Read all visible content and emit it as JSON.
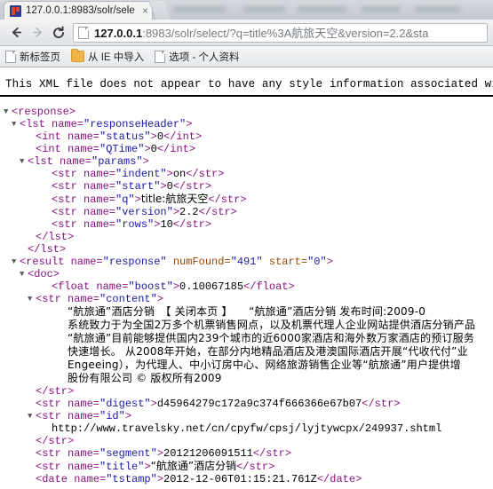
{
  "browser": {
    "tab": {
      "title": "127.0.0.1:8983/solr/sele",
      "close_label": "×",
      "favicon_name": "solr-favicon"
    },
    "toolbar": {
      "back_label": "←",
      "forward_label": "→",
      "reload_label": "⟳",
      "url_host": "127.0.0.1",
      "url_rest": ":8983/solr/select/?q=title%3A航旅天空&version=2.2&sta"
    },
    "bookmarks": [
      {
        "label": "新标签页",
        "icon": "page-icon"
      },
      {
        "label": "从 IE 中导入",
        "icon": "folder-icon"
      },
      {
        "label": "选项 - 个人资料",
        "icon": "page-icon"
      }
    ]
  },
  "page": {
    "xml_notice": "This XML file does not appear to have any style information associated wi",
    "triangle": "▼",
    "lines": {
      "response_open": "<response>",
      "lst_header_open_a": "<lst name=",
      "lst_header_name": "\"responseHeader\"",
      "gt": ">",
      "status": {
        "open": "<int name=",
        "name": "\"status\"",
        "gt": ">",
        "value": "0",
        "close": "</int>"
      },
      "qtime": {
        "open": "<int name=",
        "name": "\"QTime\"",
        "gt": ">",
        "value": "0",
        "close": "</int>"
      },
      "params_open": {
        "open": "<lst name=",
        "name": "\"params\"",
        "gt": ">"
      },
      "indent": {
        "open": "<str name=",
        "name": "\"indent\"",
        "gt": ">",
        "value": "on",
        "close": "</str>"
      },
      "start": {
        "open": "<str name=",
        "name": "\"start\"",
        "gt": ">",
        "value": "0",
        "close": "</str>"
      },
      "q": {
        "open": "<str name=",
        "name": "\"q\"",
        "gt": ">",
        "value": "title:航旅天空",
        "close": "</str>"
      },
      "version": {
        "open": "<str name=",
        "name": "\"version\"",
        "gt": ">",
        "value": "2.2",
        "close": "</str>"
      },
      "rows": {
        "open": "<str name=",
        "name": "\"rows\"",
        "gt": ">",
        "value": "10",
        "close": "</str>"
      },
      "lst_close_inner": "</lst>",
      "lst_close_outer": "</lst>",
      "result_open": "<result name=",
      "result_name": "\"response\"",
      "result_numfound_attr": " numFound=",
      "result_numfound_val": "\"491\"",
      "result_start_attr": " start=",
      "result_start_val": "\"0\"",
      "result_gt": ">",
      "doc_open": "<doc>",
      "boost": {
        "open": "<float name=",
        "name": "\"boost\"",
        "gt": ">",
        "value": "0.10067185",
        "close": "</float>"
      },
      "content_open": {
        "open": "<str name=",
        "name": "\"content\"",
        "gt": ">"
      },
      "content_text": [
        "“航旅通”酒店分销　【 关闭本页 】　　“航旅通”酒店分销 发布时间:2009-0",
        "系统致力于为全国2万多个机票销售网点，以及机票代理人企业网站提供酒店分销产品",
        "“航旅通”目前能够提供国内239个城市的近6000家酒店和海外数万家酒店的预订服务",
        "快速增长。 从2008年开始，在部分内地精品酒店及港澳国际酒店开展“代收代付”业",
        "Engeeing），为代理人、中小订房中心、网络旅游销售企业等“航旅通”用户提供增",
        "股份有限公司 © 版权所有2009"
      ],
      "content_close": "</str>",
      "digest": {
        "open": "<str name=",
        "name": "\"digest\"",
        "gt": ">",
        "value": "d45964279c172a9c374f666366e67b07",
        "close": "</str>"
      },
      "id_open": {
        "open": "<str name=",
        "name": "\"id\"",
        "gt": ">"
      },
      "id_value": "http://www.travelsky.net/cn/cpyfw/cpsj/lyjtywcpx/249937.shtml",
      "id_close": "</str>",
      "segment": {
        "open": "<str name=",
        "name": "\"segment\"",
        "gt": ">",
        "value": "20121206091511",
        "close": "</str>"
      },
      "title": {
        "open": "<str name=",
        "name": "\"title\"",
        "gt": ">",
        "value": "“航旅通”酒店分销",
        "close": "</str>"
      },
      "tstamp": {
        "open": "<date name=",
        "name": "\"tstamp\"",
        "gt": ">",
        "value": "2012-12-06T01:15:21.761Z",
        "close": "</date>"
      }
    }
  }
}
